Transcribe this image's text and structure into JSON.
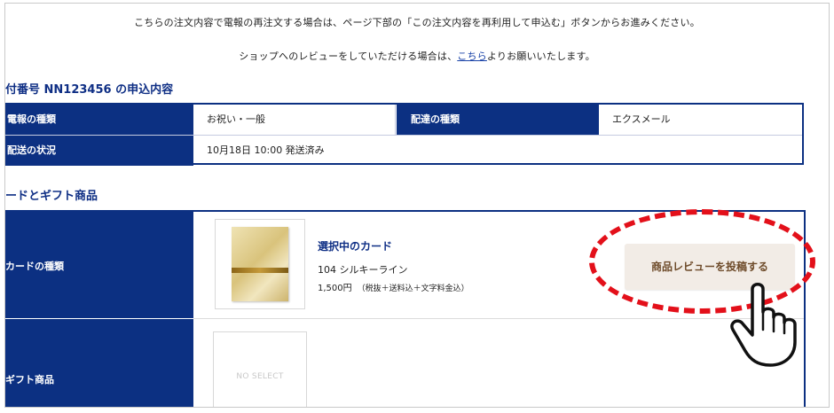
{
  "notices": {
    "reorder": "こちらの注文内容で電報の再注文する場合は、ページ下部の「この注文内容を再利用して申込む」ボタンからお進みください。",
    "review_prefix": "ショップへのレビューをしていただける場合は、",
    "review_link": "こちら",
    "review_suffix": "よりお願いいたします。"
  },
  "application": {
    "title": "付番号 NN123456 の申込内容",
    "rows": [
      {
        "h1": "電報の種類",
        "v1": "お祝い・一般",
        "h2": "配達の種類",
        "v2": "エクスメール"
      },
      {
        "h1": "配送の状況",
        "v1": "10月18日 10:00 発送済み"
      }
    ]
  },
  "cards_section": {
    "title": "ードとギフト商品",
    "card_label": "カードの種類",
    "gift_label": "ギフト商品",
    "selected_title": "選択中のカード",
    "card_name": "104 シルキーライン",
    "card_price": "1,500円",
    "card_price_note": "（税抜＋送料込＋文字料金込）",
    "gift_placeholder": "NO SELECT",
    "review_button": "商品レビューを投稿する"
  },
  "icons": {
    "hand": "pointing-hand-icon",
    "highlight": "red-dashed-ellipse"
  },
  "colors": {
    "navy": "#0c3082",
    "title_blue": "#0f2f85",
    "highlight_red": "#e3101a",
    "button_bg": "#f2ece6"
  }
}
